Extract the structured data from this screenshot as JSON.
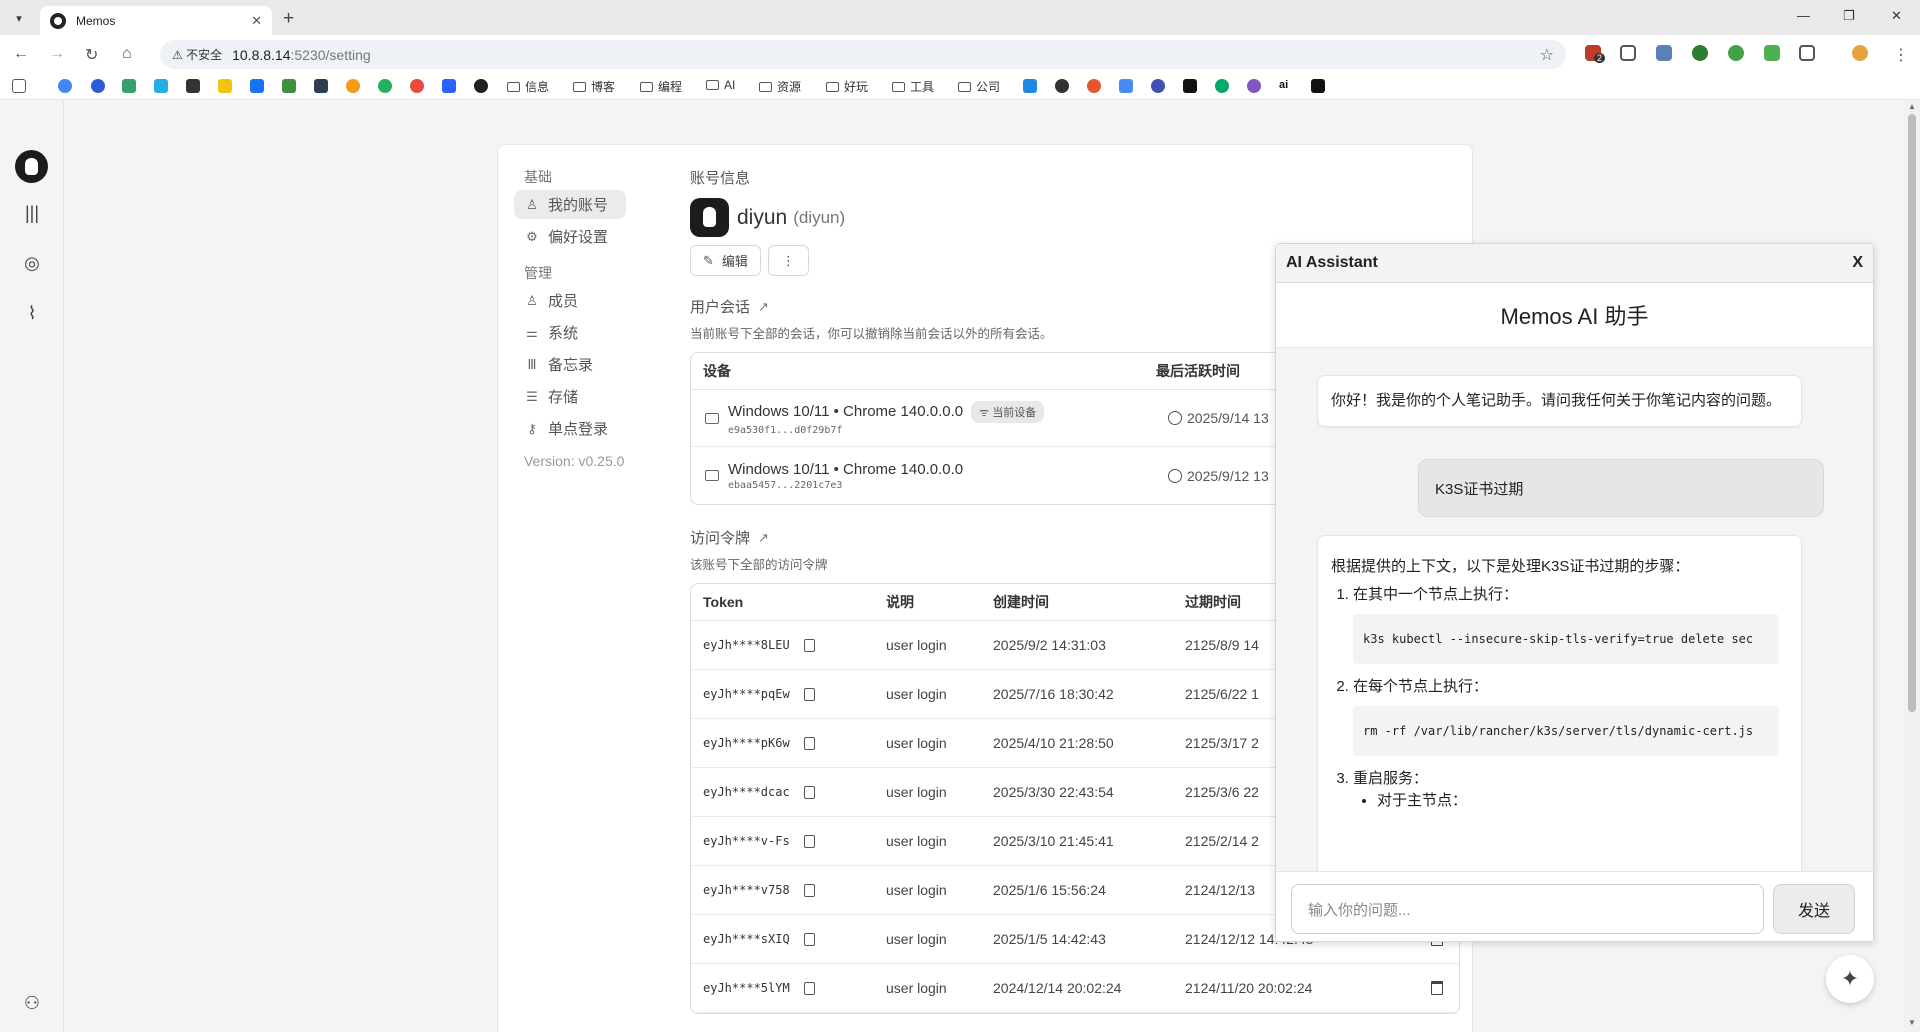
{
  "browser": {
    "tab_title": "Memos",
    "security_label": "不安全",
    "url_host": "10.8.8.14",
    "url_rest": ":5230/setting",
    "extension_badge": "2",
    "bookmark_folders": [
      "信息",
      "博客",
      "编程",
      "AI",
      "资源",
      "好玩",
      "工具",
      "公司"
    ],
    "bookmark_text_ai": "ai"
  },
  "settings_nav": {
    "group_basic": "基础",
    "my_account": "我的账号",
    "preferences": "偏好设置",
    "group_admin": "管理",
    "members": "成员",
    "system": "系统",
    "memos": "备忘录",
    "storage": "存储",
    "sso": "单点登录",
    "version": "Version: v0.25.0"
  },
  "account": {
    "section_title": "账号信息",
    "display_name": "diyun",
    "username": "(diyun)",
    "edit_label": "编辑"
  },
  "sessions": {
    "title": "用户会话",
    "description": "当前账号下全部的会话，你可以撤销除当前会话以外的所有会话。",
    "col_device": "设备",
    "col_last_active": "最后活跃时间",
    "current_badge": "当前设备",
    "rows": [
      {
        "device": "Windows 10/11 • Chrome 140.0.0.0",
        "hash": "e9a530f1...d0f29b7f",
        "time": "2025/9/14 13"
      },
      {
        "device": "Windows 10/11 • Chrome 140.0.0.0",
        "hash": "ebaa5457...2201c7e3",
        "time": "2025/9/12 13"
      }
    ]
  },
  "tokens": {
    "title": "访问令牌",
    "description": "该账号下全部的访问令牌",
    "col_token": "Token",
    "col_desc": "说明",
    "col_created": "创建时间",
    "col_expires": "过期时间",
    "rows": [
      {
        "token": "eyJh****8LEU",
        "desc": "user login",
        "created": "2025/9/2 14:31:03",
        "expires": "2125/8/9 14"
      },
      {
        "token": "eyJh****pqEw",
        "desc": "user login",
        "created": "2025/7/16 18:30:42",
        "expires": "2125/6/22 1"
      },
      {
        "token": "eyJh****pK6w",
        "desc": "user login",
        "created": "2025/4/10 21:28:50",
        "expires": "2125/3/17 2"
      },
      {
        "token": "eyJh****dcac",
        "desc": "user login",
        "created": "2025/3/30 22:43:54",
        "expires": "2125/3/6 22"
      },
      {
        "token": "eyJh****v-Fs",
        "desc": "user login",
        "created": "2025/3/10 21:45:41",
        "expires": "2125/2/14 2"
      },
      {
        "token": "eyJh****v758",
        "desc": "user login",
        "created": "2025/1/6 15:56:24",
        "expires": "2124/12/13"
      },
      {
        "token": "eyJh****sXIQ",
        "desc": "user login",
        "created": "2025/1/5 14:42:43",
        "expires": "2124/12/12 14:42:43"
      },
      {
        "token": "eyJh****5lYM",
        "desc": "user login",
        "created": "2024/12/14 20:02:24",
        "expires": "2124/11/20 20:02:24"
      }
    ]
  },
  "ai_panel": {
    "header": "AI Assistant",
    "close": "X",
    "title": "Memos AI 助手",
    "greeting": "你好！我是你的个人笔记助手。请问我任何关于你笔记内容的问题。",
    "user_message": "K3S证书过期",
    "answer_intro": "根据提供的上下文，以下是处理K3S证书过期的步骤：",
    "step1": "在其中一个节点上执行：",
    "code1": "k3s kubectl --insecure-skip-tls-verify=true delete sec",
    "step2": "在每个节点上执行：",
    "code2": "rm -rf /var/lib/rancher/k3s/server/tls/dynamic-cert.js",
    "step3": "重启服务：",
    "sub1": "对于主节点：",
    "input_placeholder": "输入你的问题...",
    "send_label": "发送"
  }
}
